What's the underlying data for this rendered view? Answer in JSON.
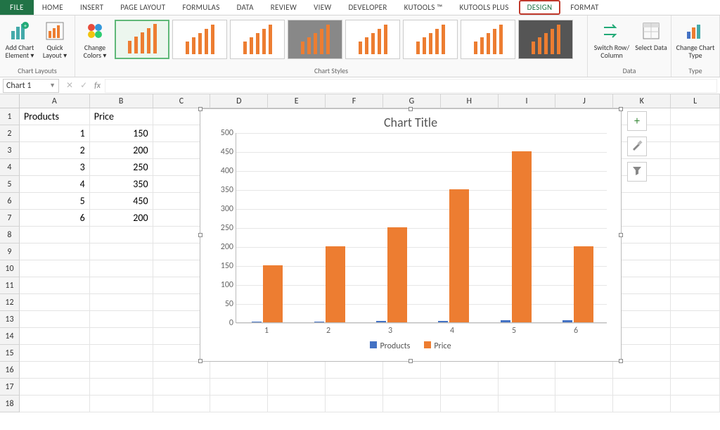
{
  "ribbon_tabs": {
    "file": "FILE",
    "items": [
      "HOME",
      "INSERT",
      "PAGE LAYOUT",
      "FORMULAS",
      "DATA",
      "REVIEW",
      "VIEW",
      "DEVELOPER",
      "KUTOOLS ™",
      "KUTOOLS PLUS",
      "DESIGN",
      "FORMAT"
    ]
  },
  "ribbon": {
    "chart_layouts": {
      "add_chart_element": "Add Chart Element ▾",
      "quick_layout": "Quick Layout ▾",
      "label": "Chart Layouts"
    },
    "chart_styles": {
      "change_colors": "Change Colors ▾",
      "label": "Chart Styles"
    },
    "data": {
      "switch_row_col": "Switch Row/ Column",
      "select_data": "Select Data",
      "label": "Data"
    },
    "type": {
      "change_chart_type": "Change Chart Type",
      "label": "Type"
    }
  },
  "name_box": "Chart 1",
  "fx": "fx",
  "columns": [
    "A",
    "B",
    "C",
    "D",
    "E",
    "F",
    "G",
    "H",
    "I",
    "J",
    "K",
    "L"
  ],
  "table": {
    "headers": {
      "A": "Products",
      "B": "Price"
    },
    "rows": [
      {
        "A": "1",
        "B": "150"
      },
      {
        "A": "2",
        "B": "200"
      },
      {
        "A": "3",
        "B": "250"
      },
      {
        "A": "4",
        "B": "350"
      },
      {
        "A": "5",
        "B": "450"
      },
      {
        "A": "6",
        "B": "200"
      }
    ]
  },
  "chart_data": {
    "type": "bar",
    "title": "Chart Title",
    "categories": [
      "1",
      "2",
      "3",
      "4",
      "5",
      "6"
    ],
    "series": [
      {
        "name": "Products",
        "values": [
          1,
          2,
          3,
          4,
          5,
          6
        ],
        "color": "#4472c4"
      },
      {
        "name": "Price",
        "values": [
          150,
          200,
          250,
          350,
          450,
          200
        ],
        "color": "#ed7d31"
      }
    ],
    "ylim": [
      0,
      500
    ],
    "ystep": 50,
    "xlabel": "",
    "ylabel": ""
  },
  "side_buttons": {
    "plus": "+",
    "brush": "✎",
    "filter": "▾"
  }
}
